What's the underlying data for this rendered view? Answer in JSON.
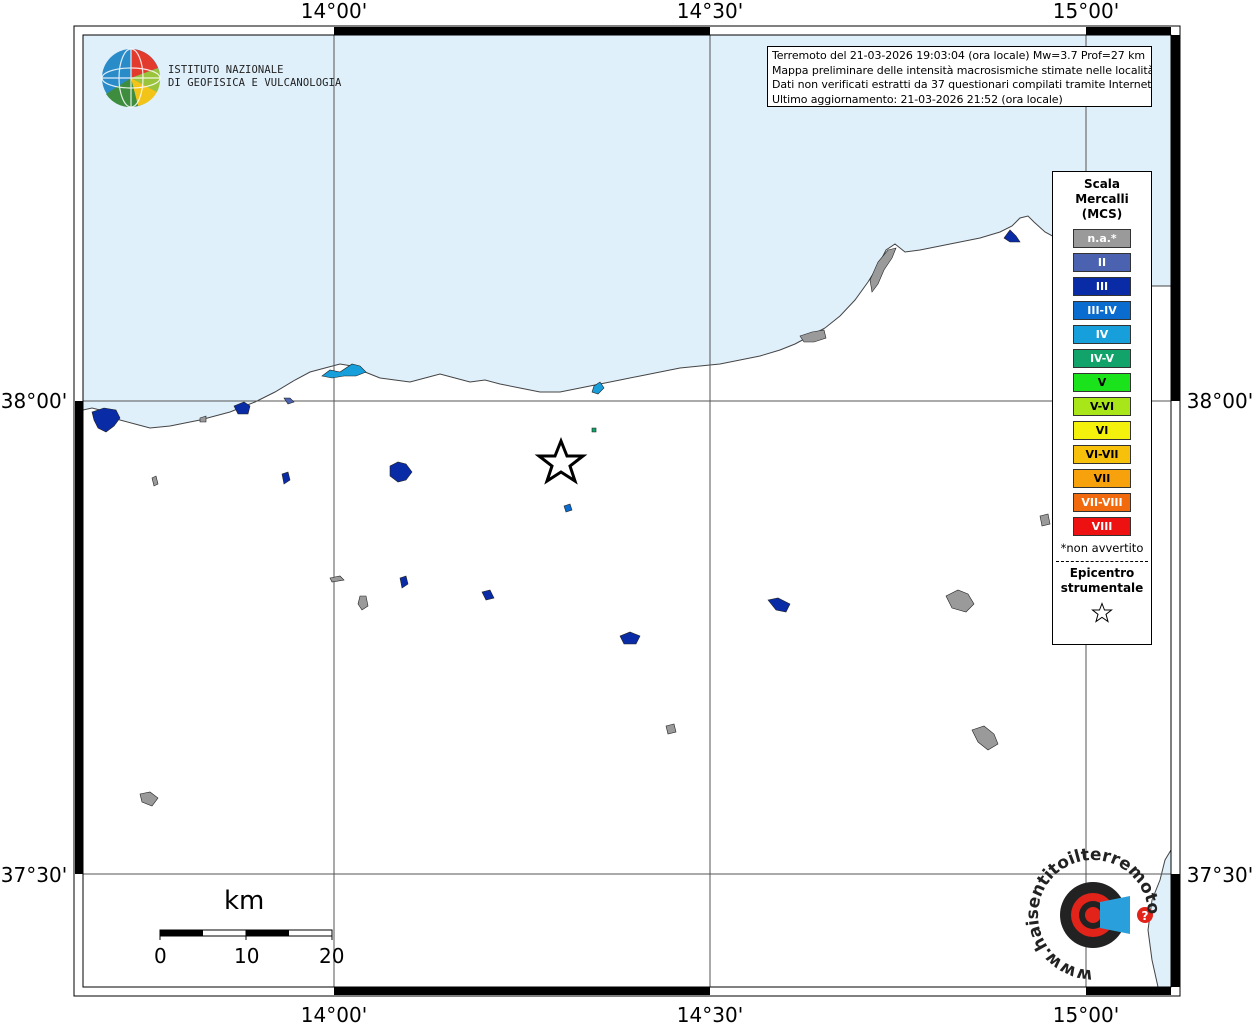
{
  "coordinates": {
    "lon_top": [
      "14°00'",
      "14°30'",
      "15°00'"
    ],
    "lon_bottom": [
      "14°00'",
      "14°30'",
      "15°00'"
    ],
    "lat_left": [
      "38°00'",
      "37°30'"
    ],
    "lat_right": [
      "38°00'",
      "37°30'"
    ]
  },
  "logo": {
    "line1": "ISTITUTO NAZIONALE",
    "line2": "DI GEOFISICA E VULCANOLOGIA"
  },
  "info": {
    "line1": "Terremoto del 21-03-2026 19:03:04 (ora locale) Mw=3.7 Prof=27 km",
    "line2": "Mappa preliminare delle intensità macrosismiche stimate nelle località",
    "line3": "Dati non verificati estratti da 37 questionari compilati tramite Internet.",
    "line4": "Ultimo aggiornamento: 21-03-2026 21:52 (ora locale)"
  },
  "legend": {
    "title1": "Scala",
    "title2": "Mercalli",
    "title3": "(MCS)",
    "items": [
      {
        "label": "n.a.*",
        "color": "#9a9a9a"
      },
      {
        "label": "II",
        "color": "#4a62b0"
      },
      {
        "label": "III",
        "color": "#0a2ba6"
      },
      {
        "label": "III-IV",
        "color": "#0a6ccf"
      },
      {
        "label": "IV",
        "color": "#179fdc"
      },
      {
        "label": "IV-V",
        "color": "#11a36a"
      },
      {
        "label": "V",
        "color": "#1be31b"
      },
      {
        "label": "V-VI",
        "color": "#a8e61a"
      },
      {
        "label": "VI",
        "color": "#f4f20c"
      },
      {
        "label": "VI-VII",
        "color": "#f7c10b"
      },
      {
        "label": "VII",
        "color": "#f7a10c"
      },
      {
        "label": "VII-VIII",
        "color": "#f26a0e"
      },
      {
        "label": "VIII",
        "color": "#ee1111"
      }
    ],
    "note": "*non avvertito",
    "epicenter1": "Epicentro",
    "epicenter2": "strumentale"
  },
  "scale": {
    "unit": "km",
    "labels": [
      "0",
      "10",
      "20"
    ]
  },
  "watermark": {
    "text": "www.haisentitoilterremoto.it",
    "badge": "?"
  },
  "colors": {
    "sea": "#dff0fb",
    "land": "#ffffff",
    "coast": "#444444",
    "na": "#9a9a9a",
    "ii": "#4a62b0",
    "iii": "#0a2ba6",
    "iii_iv": "#0a6ccf",
    "iv": "#179fdc",
    "iv_v": "#11a36a"
  }
}
